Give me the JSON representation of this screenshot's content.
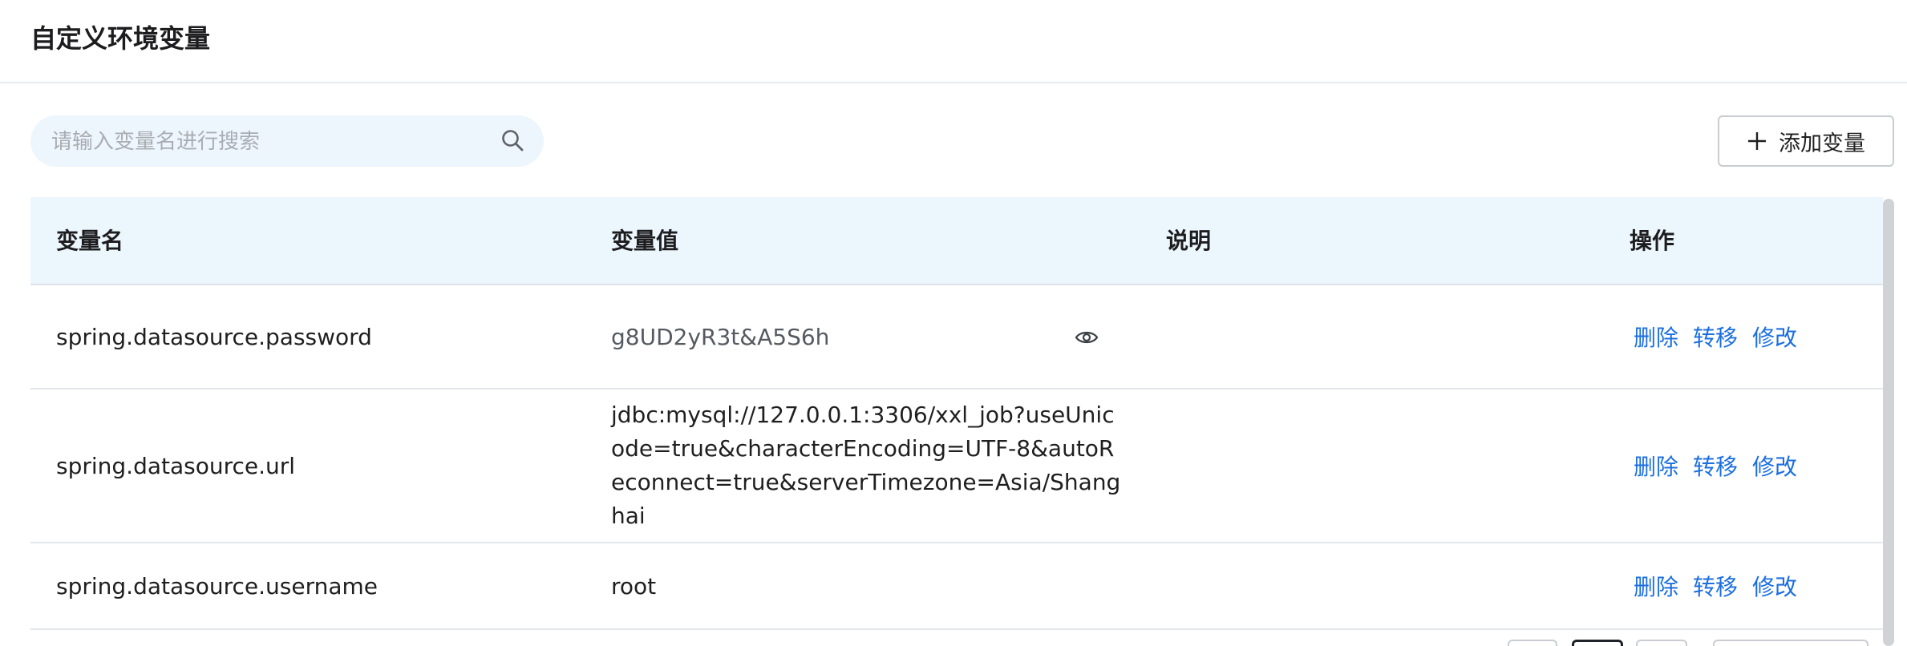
{
  "header": {
    "title": "自定义环境变量"
  },
  "search": {
    "placeholder": "请输入变量名进行搜索",
    "value": ""
  },
  "toolbar": {
    "add_label": "添加变量"
  },
  "table": {
    "columns": [
      "变量名",
      "变量值",
      "说明",
      "操作"
    ],
    "rows": [
      {
        "name": "spring.datasource.password",
        "value": "g8UD2yR3t&A5S6h",
        "description": "",
        "actions": [
          "删除",
          "转移",
          "修改"
        ]
      },
      {
        "name": "spring.datasource.url",
        "value": "jdbc:mysql://127.0.0.1:3306/xxl_job?useUnicode=true&characterEncoding=UTF-8&autoReconnect=true&serverTimezone=Asia/Shanghai",
        "description": "",
        "actions": [
          "删除",
          "转移",
          "修改"
        ]
      },
      {
        "name": "spring.datasource.username",
        "value": "root",
        "description": "",
        "actions": [
          "删除",
          "转移",
          "修改"
        ]
      }
    ]
  },
  "colors": {
    "accent_link": "#1b6fe0",
    "header_bg": "#ecf6fd",
    "search_bg": "#eef6fd"
  }
}
